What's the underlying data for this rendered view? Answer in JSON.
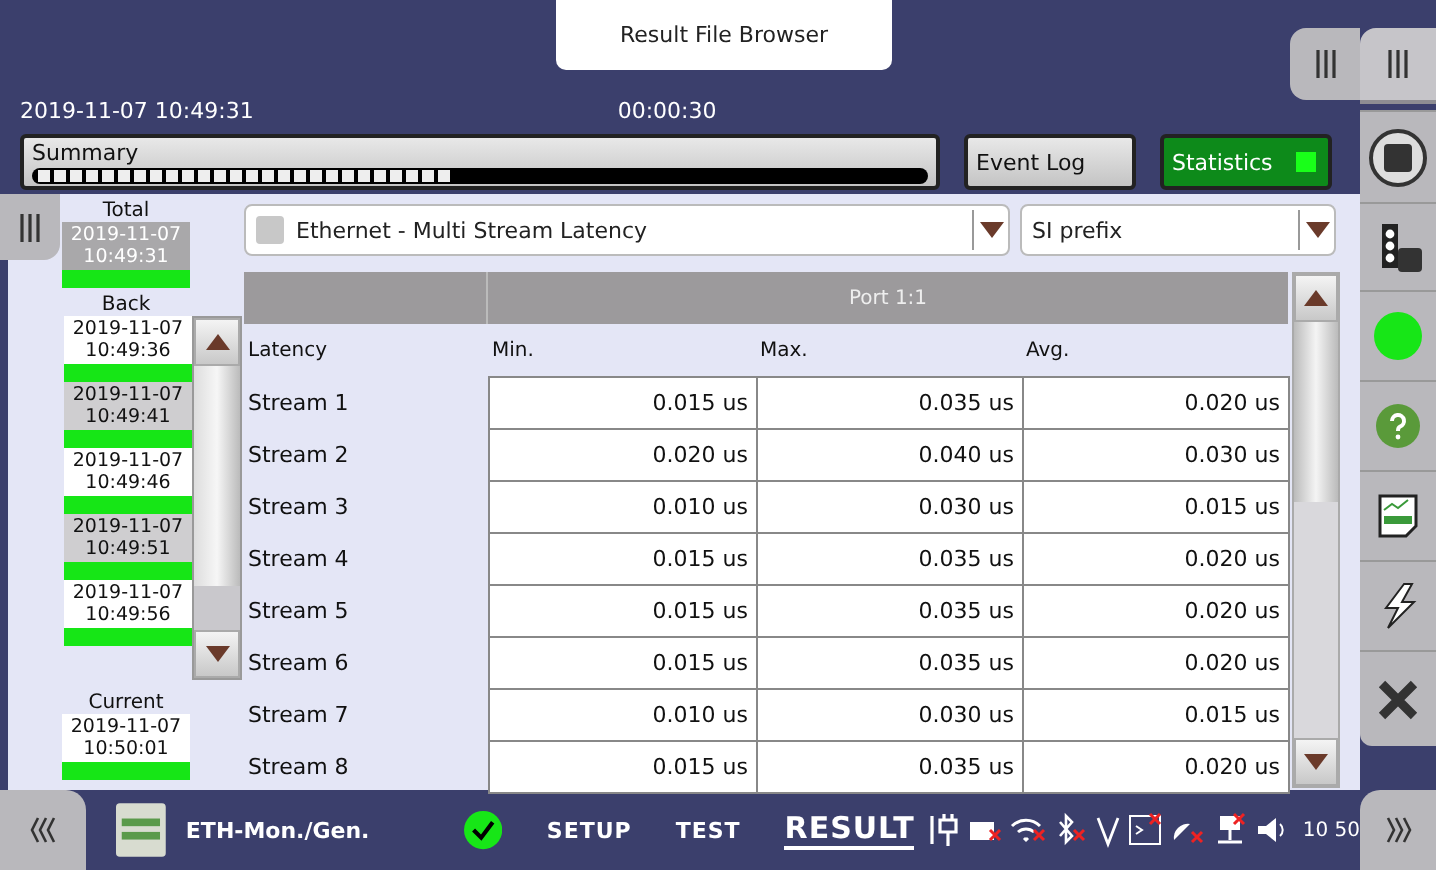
{
  "title_tab": "Result File Browser",
  "header": {
    "timestamp": "2019-11-07 10:49:31",
    "elapsed": "00:00:30"
  },
  "tabs": [
    {
      "label": "Summary",
      "kind": "progress",
      "level": 0.47,
      "selected": false
    },
    {
      "label": "Event Log",
      "kind": "plain",
      "selected": false
    },
    {
      "label": "Statistics",
      "kind": "plain",
      "selected": true
    }
  ],
  "history": {
    "total_label": "Total",
    "total": {
      "date": "2019-11-07",
      "time": "10:49:31"
    },
    "back_label": "Back",
    "back": [
      {
        "date": "2019-11-07",
        "time": "10:49:36"
      },
      {
        "date": "2019-11-07",
        "time": "10:49:41"
      },
      {
        "date": "2019-11-07",
        "time": "10:49:46"
      },
      {
        "date": "2019-11-07",
        "time": "10:49:51"
      },
      {
        "date": "2019-11-07",
        "time": "10:49:56"
      }
    ],
    "current_label": "Current",
    "current": {
      "date": "2019-11-07",
      "time": "10:50:01"
    }
  },
  "view_select": "Ethernet - Multi Stream Latency",
  "prefix_select": "SI prefix",
  "table": {
    "group": "Port 1:1",
    "columns": [
      "Latency",
      "Min.",
      "Max.",
      "Avg."
    ],
    "rows": [
      {
        "label": "Stream 1",
        "values": [
          "0.015 us",
          "0.035 us",
          "0.020 us"
        ]
      },
      {
        "label": "Stream 2",
        "values": [
          "0.020 us",
          "0.040 us",
          "0.030 us"
        ]
      },
      {
        "label": "Stream 3",
        "values": [
          "0.010 us",
          "0.030 us",
          "0.015 us"
        ]
      },
      {
        "label": "Stream 4",
        "values": [
          "0.015 us",
          "0.035 us",
          "0.020 us"
        ]
      },
      {
        "label": "Stream 5",
        "values": [
          "0.015 us",
          "0.035 us",
          "0.020 us"
        ]
      },
      {
        "label": "Stream 6",
        "values": [
          "0.015 us",
          "0.035 us",
          "0.020 us"
        ]
      },
      {
        "label": "Stream 7",
        "values": [
          "0.010 us",
          "0.030 us",
          "0.015 us"
        ]
      },
      {
        "label": "Stream 8",
        "values": [
          "0.015 us",
          "0.035 us",
          "0.020 us"
        ]
      }
    ]
  },
  "bottom_bar": {
    "module": "ETH-Mon./Gen.",
    "nav": [
      {
        "label": "SETUP",
        "selected": false
      },
      {
        "label": "TEST",
        "selected": false
      },
      {
        "label": "RESULT",
        "selected": true
      }
    ],
    "clock": "10 50"
  }
}
